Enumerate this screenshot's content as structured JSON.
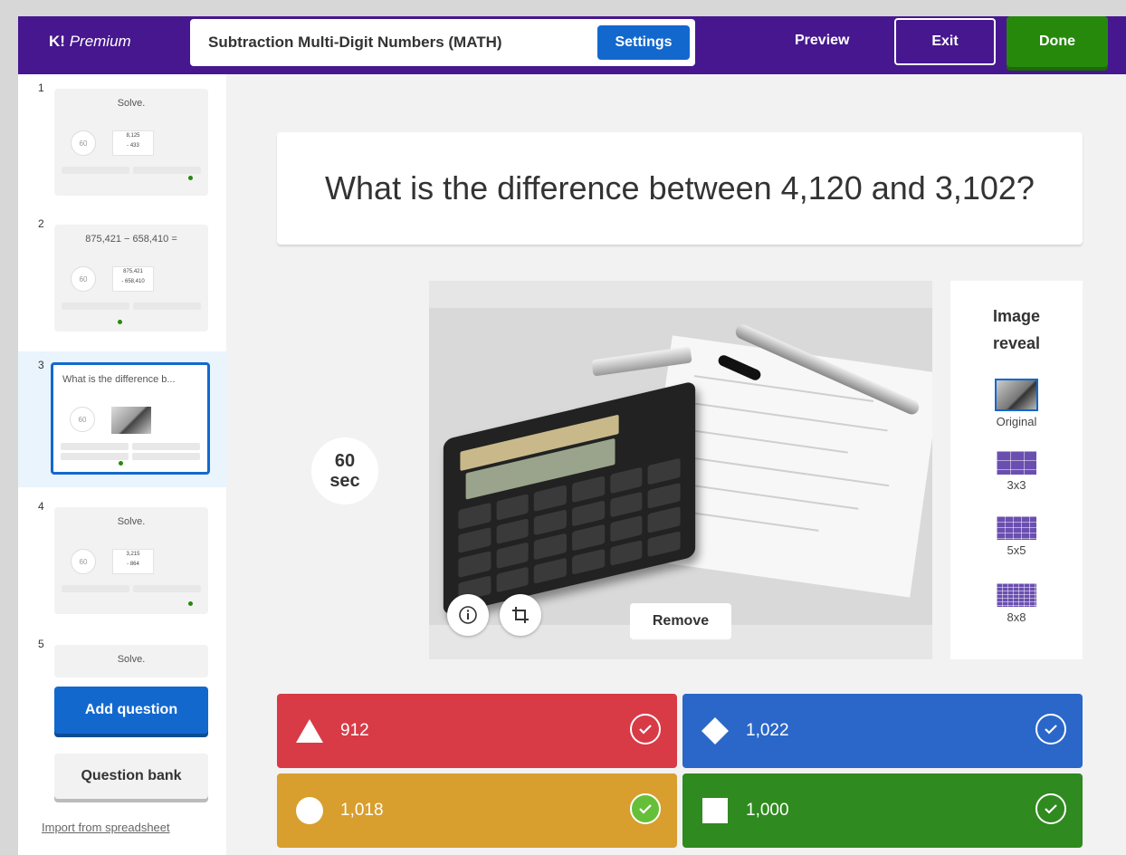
{
  "header": {
    "logo_k": "K!",
    "logo_text": "Premium",
    "title": "Subtraction Multi-Digit Numbers (MATH)",
    "settings_label": "Settings",
    "preview_label": "Preview",
    "exit_label": "Exit",
    "done_label": "Done"
  },
  "sidebar": {
    "slides": [
      {
        "num": "1",
        "question": "Solve.",
        "timer": "60",
        "img_text_1": "8,125",
        "img_text_2": "- 433"
      },
      {
        "num": "2",
        "question": "875,421 − 658,410 =",
        "timer": "60",
        "img_text_1": "875,421",
        "img_text_2": "- 658,410"
      },
      {
        "num": "3",
        "question": "What is the difference b...",
        "timer": "60"
      },
      {
        "num": "4",
        "question": "Solve.",
        "timer": "60",
        "img_text_1": "3,215",
        "img_text_2": "- 864"
      },
      {
        "num": "5",
        "question": "Solve."
      }
    ],
    "add_question_label": "Add question",
    "question_bank_label": "Question bank",
    "import_label": "Import from spreadsheet"
  },
  "question": {
    "text": "What is the difference between 4,120 and 3,102?",
    "timer_value": "60",
    "timer_unit": "sec"
  },
  "image": {
    "remove_label": "Remove"
  },
  "image_reveal": {
    "title_line1": "Image",
    "title_line2": "reveal",
    "options": [
      "Original",
      "3x3",
      "5x5",
      "8x8"
    ],
    "selected": "Original"
  },
  "answers": [
    {
      "text": "912",
      "shape": "triangle",
      "color": "#d83a46",
      "correct": false
    },
    {
      "text": "1,022",
      "shape": "diamond",
      "color": "#2a67c9",
      "correct": false
    },
    {
      "text": "1,018",
      "shape": "circle",
      "color": "#d89e2e",
      "correct": true
    },
    {
      "text": "1,000",
      "shape": "square",
      "color": "#2f8a1f",
      "correct": false
    }
  ],
  "colors": {
    "brand_purple": "#46178f",
    "primary_blue": "#1368ce",
    "done_green": "#26890c"
  }
}
